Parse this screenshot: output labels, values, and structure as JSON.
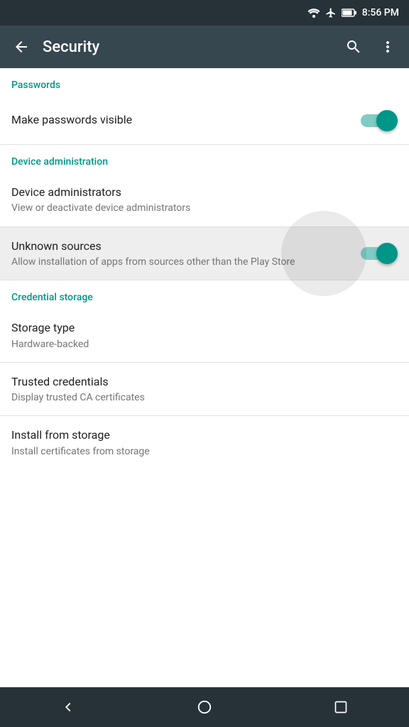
{
  "statusBar": {
    "time": "8:56 PM"
  },
  "appBar": {
    "title": "Security",
    "backLabel": "back",
    "searchLabel": "search",
    "moreLabel": "more options"
  },
  "sections": [
    {
      "id": "passwords",
      "header": "Passwords",
      "items": [
        {
          "id": "make-passwords-visible",
          "title": "Make passwords visible",
          "subtitle": null,
          "hasToggle": true,
          "toggleOn": true,
          "highlighted": false
        }
      ]
    },
    {
      "id": "device-administration",
      "header": "Device administration",
      "items": [
        {
          "id": "device-administrators",
          "title": "Device administrators",
          "subtitle": "View or deactivate device administrators",
          "hasToggle": false,
          "highlighted": false
        },
        {
          "id": "unknown-sources",
          "title": "Unknown sources",
          "subtitle": "Allow installation of apps from sources other than the Play Store",
          "hasToggle": true,
          "toggleOn": true,
          "highlighted": true
        }
      ]
    },
    {
      "id": "credential-storage",
      "header": "Credential storage",
      "items": [
        {
          "id": "storage-type",
          "title": "Storage type",
          "subtitle": "Hardware-backed",
          "hasToggle": false,
          "highlighted": false
        },
        {
          "id": "trusted-credentials",
          "title": "Trusted credentials",
          "subtitle": "Display trusted CA certificates",
          "hasToggle": false,
          "highlighted": false
        },
        {
          "id": "install-from-storage",
          "title": "Install from storage",
          "subtitle": "Install certificates from storage",
          "hasToggle": false,
          "highlighted": false
        }
      ]
    }
  ],
  "navBar": {
    "back": "back",
    "home": "home",
    "recents": "recents"
  },
  "colors": {
    "teal": "#009688",
    "tealLight": "#80cbc4"
  }
}
